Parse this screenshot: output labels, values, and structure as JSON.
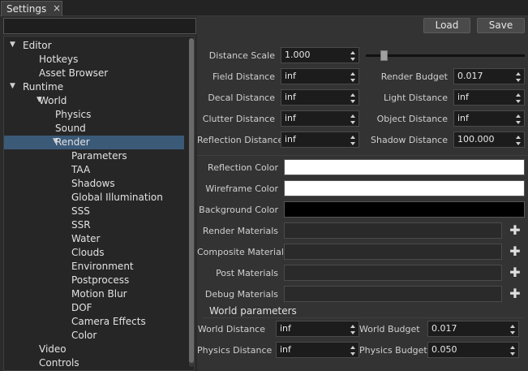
{
  "tab": {
    "title": "Settings",
    "close": "×"
  },
  "search": {
    "placeholder": ""
  },
  "tree": [
    {
      "label": "Editor",
      "expanded": true,
      "level": 0
    },
    {
      "label": "Hotkeys",
      "level": 1
    },
    {
      "label": "Asset Browser",
      "level": 1
    },
    {
      "label": "Runtime",
      "expanded": true,
      "level": 0
    },
    {
      "label": "World",
      "expanded": true,
      "level": 1
    },
    {
      "label": "Physics",
      "level": 2
    },
    {
      "label": "Sound",
      "level": 2
    },
    {
      "label": "Render",
      "expanded": true,
      "level": 2,
      "selected": true
    },
    {
      "label": "Parameters",
      "level": 3
    },
    {
      "label": "TAA",
      "level": 3
    },
    {
      "label": "Shadows",
      "level": 3
    },
    {
      "label": "Global Illumination",
      "level": 3
    },
    {
      "label": "SSS",
      "level": 3
    },
    {
      "label": "SSR",
      "level": 3
    },
    {
      "label": "Water",
      "level": 3
    },
    {
      "label": "Clouds",
      "level": 3
    },
    {
      "label": "Environment",
      "level": 3
    },
    {
      "label": "Postprocess",
      "level": 3
    },
    {
      "label": "Motion Blur",
      "level": 3
    },
    {
      "label": "DOF",
      "level": 3
    },
    {
      "label": "Camera Effects",
      "level": 3
    },
    {
      "label": "Color",
      "level": 3
    },
    {
      "label": "Video",
      "level": 1
    },
    {
      "label": "Controls",
      "level": 1
    }
  ],
  "toolbar": {
    "load_label": "Load",
    "save_label": "Save"
  },
  "distance_scale": {
    "label": "Distance Scale",
    "value": "1.000"
  },
  "left_fields": [
    {
      "label": "Field Distance",
      "value": "inf"
    },
    {
      "label": "Decal Distance",
      "value": "inf"
    },
    {
      "label": "Clutter Distance",
      "value": "inf"
    },
    {
      "label": "Reflection Distance",
      "value": "inf"
    }
  ],
  "right_fields": [
    {
      "label": "Render Budget",
      "value": "0.017"
    },
    {
      "label": "Light Distance",
      "value": "inf"
    },
    {
      "label": "Object Distance",
      "value": "inf"
    },
    {
      "label": "Shadow Distance",
      "value": "100.000"
    }
  ],
  "colors": [
    {
      "label": "Reflection Color",
      "hex": "#ffffff"
    },
    {
      "label": "Wireframe Color",
      "hex": "#ffffff"
    },
    {
      "label": "Background Color",
      "hex": "#000000"
    }
  ],
  "materials": [
    {
      "label": "Render Materials"
    },
    {
      "label": "Composite Materials"
    },
    {
      "label": "Post Materials"
    },
    {
      "label": "Debug Materials"
    }
  ],
  "world_params": {
    "title": "World parameters",
    "left": [
      {
        "label": "World Distance",
        "value": "inf"
      },
      {
        "label": "Physics Distance",
        "value": "inf"
      }
    ],
    "right": [
      {
        "label": "World Budget",
        "value": "0.017"
      },
      {
        "label": "Physics Budget",
        "value": "0.050"
      }
    ]
  },
  "accent": "#3b5a78"
}
